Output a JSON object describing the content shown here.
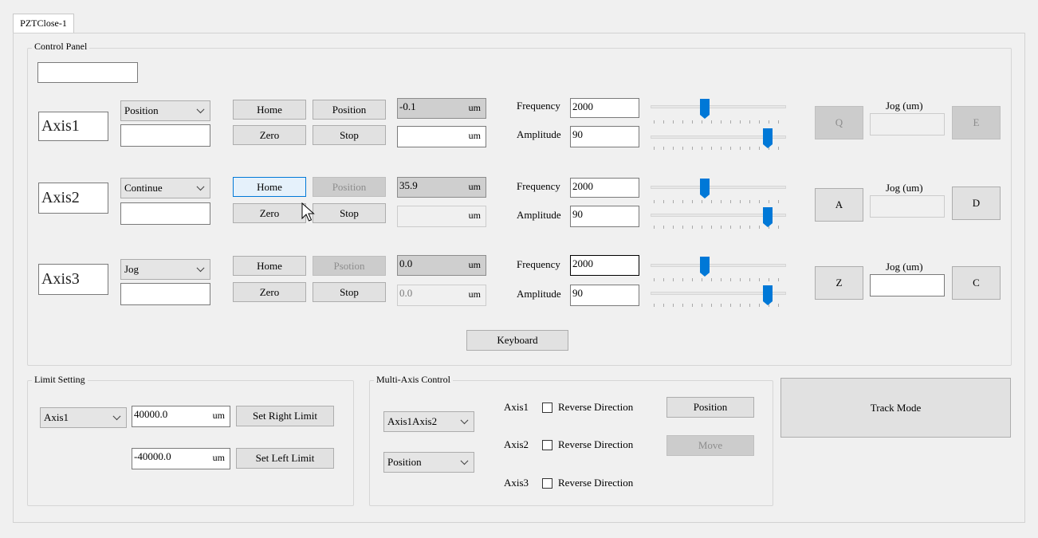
{
  "tab": {
    "label": "PZTClose-1"
  },
  "control_panel": {
    "title": "Control Panel",
    "top_field": "",
    "keyboard_label": "Keyboard",
    "unit": "um",
    "freq_label": "Frequency",
    "amp_label": "Amplitude",
    "jog_label": "Jog (um)",
    "home_label": "Home",
    "zero_label": "Zero",
    "stop_label": "Stop",
    "axes": [
      {
        "name": "Axis1",
        "mode": "Position",
        "mode_input": "",
        "position_btn": "Position",
        "readout": "-0.1",
        "target": "",
        "frequency": "2000",
        "amplitude": "90",
        "freq_slider": 0.4,
        "amp_slider": 0.9,
        "jog_left": "Q",
        "jog_right": "E",
        "jog_value": ""
      },
      {
        "name": "Axis2",
        "mode": "Continue",
        "mode_input": "",
        "position_btn": "Position",
        "readout": "35.9",
        "target": "",
        "frequency": "2000",
        "amplitude": "90",
        "freq_slider": 0.4,
        "amp_slider": 0.9,
        "jog_left": "A",
        "jog_right": "D",
        "jog_value": ""
      },
      {
        "name": "Axis3",
        "mode": "Jog",
        "mode_input": "",
        "position_btn": "Psotion",
        "readout": "0.0",
        "target": "0.0",
        "frequency": "2000",
        "amplitude": "90",
        "freq_slider": 0.4,
        "amp_slider": 0.9,
        "jog_left": "Z",
        "jog_right": "C",
        "jog_value": ""
      }
    ]
  },
  "limit_setting": {
    "title": "Limit Setting",
    "axis_select": "Axis1",
    "right_value": "40000.0",
    "left_value": "-40000.0",
    "unit": "um",
    "set_right_label": "Set Right Limit",
    "set_left_label": "Set Left Limit"
  },
  "multi_axis": {
    "title": "Multi-Axis Control",
    "axes_select": "Axis1Axis2",
    "mode_select": "Position",
    "axis1": "Axis1",
    "axis2": "Axis2",
    "axis3": "Axis3",
    "reverse_label": "Reverse Direction",
    "position_label": "Position",
    "move_label": "Move"
  },
  "track_mode_label": "Track Mode",
  "icons": {
    "cursor": "mouse-pointer-icon",
    "dropdown": "chevron-down-icon"
  }
}
